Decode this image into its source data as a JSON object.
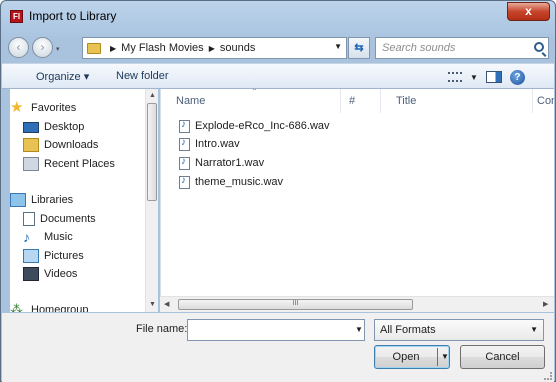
{
  "window": {
    "title": "Import to Library",
    "close_glyph": "x",
    "app_icon_letter": "Fl"
  },
  "address_bar": {
    "crumbs": [
      "My Flash Movies",
      "sounds"
    ],
    "search_placeholder": "Search sounds"
  },
  "toolbar": {
    "organize_label": "Organize ▾",
    "new_folder_label": "New folder"
  },
  "nav_pane": {
    "favorites": {
      "label": "Favorites",
      "items": [
        "Desktop",
        "Downloads",
        "Recent Places"
      ]
    },
    "libraries": {
      "label": "Libraries",
      "items": [
        "Documents",
        "Music",
        "Pictures",
        "Videos"
      ]
    },
    "homegroup": {
      "label": "Homegroup"
    }
  },
  "file_list": {
    "columns": [
      "Name",
      "#",
      "Title",
      "Cont"
    ],
    "files": [
      "Explode-eRco_Inc-686.wav",
      "Intro.wav",
      "Narrator1.wav",
      "theme_music.wav"
    ]
  },
  "bottom": {
    "file_name_label": "File name:",
    "file_name_value": "",
    "filter_value": "All Formats",
    "open_label": "Open",
    "cancel_label": "Cancel"
  }
}
